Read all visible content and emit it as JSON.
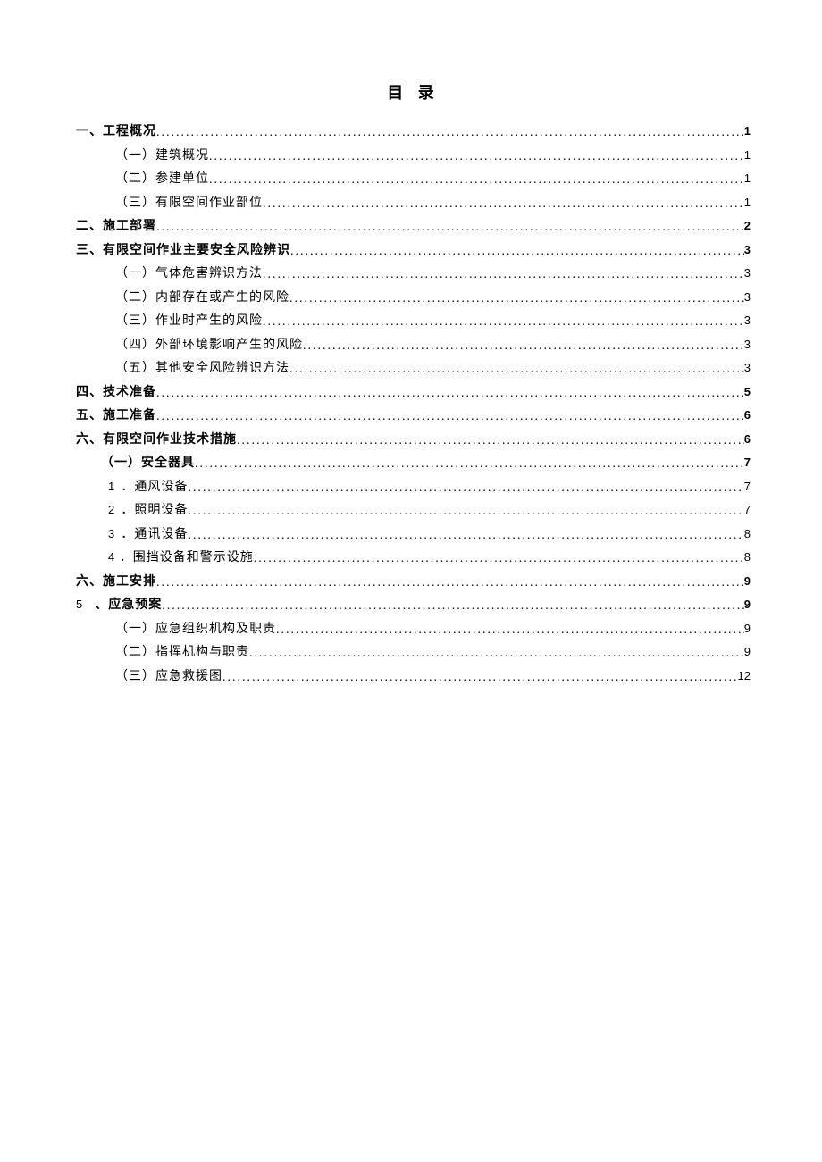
{
  "title": "目 录",
  "toc": [
    {
      "label": "一、工程概况",
      "page": "1",
      "level": 0,
      "bold": true
    },
    {
      "label": "（一）建筑概况",
      "page": "1",
      "level": 1,
      "bold": false
    },
    {
      "label": "（二）参建单位",
      "page": "1",
      "level": 1,
      "bold": false
    },
    {
      "label": "（三）有限空间作业部位",
      "page": "1",
      "level": 1,
      "bold": false
    },
    {
      "label": "二、施工部署",
      "page": "2",
      "level": 0,
      "bold": true
    },
    {
      "label": "三、有限空间作业主要安全风险辨识",
      "page": "3",
      "level": 0,
      "bold": true
    },
    {
      "label": "（一）气体危害辨识方法",
      "page": "3",
      "level": 1,
      "bold": false
    },
    {
      "label": "（二）内部存在或产生的风险",
      "page": "3",
      "level": 1,
      "bold": false
    },
    {
      "label": "（三）作业时产生的风险",
      "page": "3",
      "level": 1,
      "bold": false
    },
    {
      "label": "（四）外部环境影响产生的风险",
      "page": "3",
      "level": 1,
      "bold": false
    },
    {
      "label": "（五）其他安全风险辨识方法",
      "page": "3",
      "level": 1,
      "bold": false
    },
    {
      "label": "四、技术准备",
      "page": "5",
      "level": 0,
      "bold": true
    },
    {
      "label": "五、施工准备",
      "page": "6",
      "level": 0,
      "bold": true
    },
    {
      "label": "六、有限空间作业技术措施",
      "page": "6",
      "level": 0,
      "bold": true
    },
    {
      "label": "（一）安全器具",
      "page": "7",
      "level": 2,
      "bold": true
    },
    {
      "num": "1",
      "label": "．通风设备",
      "page": "7",
      "level": 3,
      "bold": false
    },
    {
      "num": "2",
      "label": "．照明设备",
      "page": "7",
      "level": 3,
      "bold": false
    },
    {
      "num": "3",
      "label": "．通讯设备",
      "page": "8",
      "level": 3,
      "bold": false
    },
    {
      "num": "4",
      "label": "．围挡设备和警示设施",
      "page": "8",
      "level": 3,
      "bold": false
    },
    {
      "label": "六、施工安排",
      "page": "9",
      "level": 0,
      "bold": true
    },
    {
      "five": "5",
      "label": "、应急预案",
      "page": "9",
      "level": 0,
      "bold": true
    },
    {
      "label": "（一）应急组织机构及职责",
      "page": "9",
      "level": 1,
      "bold": false
    },
    {
      "label": "（二）指挥机构与职责",
      "page": "9",
      "level": 1,
      "bold": false
    },
    {
      "label": "（三）应急救援图",
      "page": "12",
      "level": 1,
      "bold": false
    }
  ]
}
